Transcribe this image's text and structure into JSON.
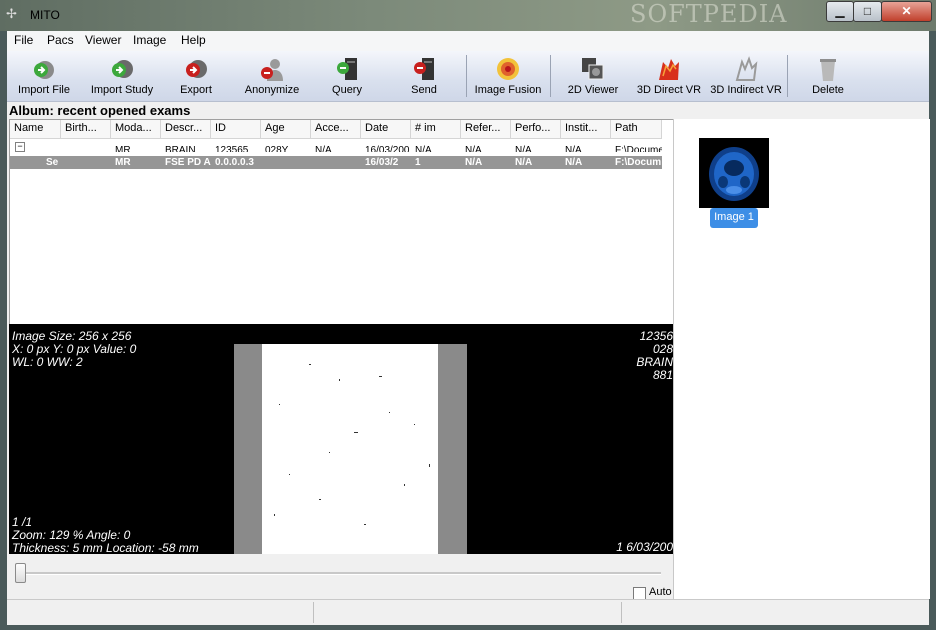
{
  "window": {
    "title": "MITO",
    "watermark": "SOFTPEDIA",
    "buttons": {
      "minimize": "▁",
      "maximize": "□",
      "close": "✕"
    }
  },
  "menu": [
    "File",
    "Pacs",
    "Viewer",
    "Image",
    "Help"
  ],
  "toolbar": [
    {
      "label": "Import File",
      "icon": "import-file-icon"
    },
    {
      "label": "Import Study",
      "icon": "import-study-icon"
    },
    {
      "label": "Export",
      "icon": "export-icon"
    },
    {
      "label": "Anonymize",
      "icon": "anonymize-icon"
    },
    {
      "label": "Query",
      "icon": "query-icon"
    },
    {
      "label": "Send",
      "icon": "send-icon"
    },
    {
      "label": "Image Fusion",
      "icon": "image-fusion-icon"
    },
    {
      "label": "2D Viewer",
      "icon": "2d-viewer-icon"
    },
    {
      "label": "3D Direct VR",
      "icon": "3d-direct-vr-icon"
    },
    {
      "label": "3D Indirect VR",
      "icon": "3d-indirect-vr-icon"
    },
    {
      "label": "Delete",
      "icon": "delete-icon"
    }
  ],
  "album": {
    "title": "Album: recent opened exams",
    "columns": [
      "Name",
      "Birth...",
      "Moda...",
      "Descr...",
      "ID",
      "Age",
      "Acce...",
      "Date",
      "# im",
      "Refer...",
      "Perfo...",
      "Instit...",
      "Path"
    ],
    "study_row": [
      "",
      "",
      "MR",
      "BRAIN",
      "123565",
      "028Y",
      "N/A",
      "16/03/200",
      "N/A",
      "N/A",
      "N/A",
      "N/A",
      "F:\\Docume"
    ],
    "series_row": [
      "Se",
      "",
      "MR",
      "FSE PD A",
      "0.0.0.0.3",
      "",
      "",
      "16/03/2",
      "1",
      "N/A",
      "N/A",
      "N/A",
      "F:\\Docum"
    ],
    "tree_toggle": "−"
  },
  "thumbnails": [
    {
      "label": "Image 1"
    }
  ],
  "viewer": {
    "top_left": [
      "Image Size: 256 x 256",
      "X: 0 px Y: 0 px Value: 0",
      "WL: 0 WW: 2"
    ],
    "top_right": [
      "12356",
      "028",
      "BRAIN",
      "881"
    ],
    "bottom_left": [
      "1 /1",
      "Zoom: 129 % Angle: 0",
      "Thickness: 5 mm Location: -58 mm"
    ],
    "bottom_right": [
      "1 6/03/200"
    ]
  },
  "slider": {
    "value": 0.0
  },
  "auto_label": "Auto",
  "colors": {
    "selection": "#969696",
    "thumb_label": "#3d8ee6"
  }
}
